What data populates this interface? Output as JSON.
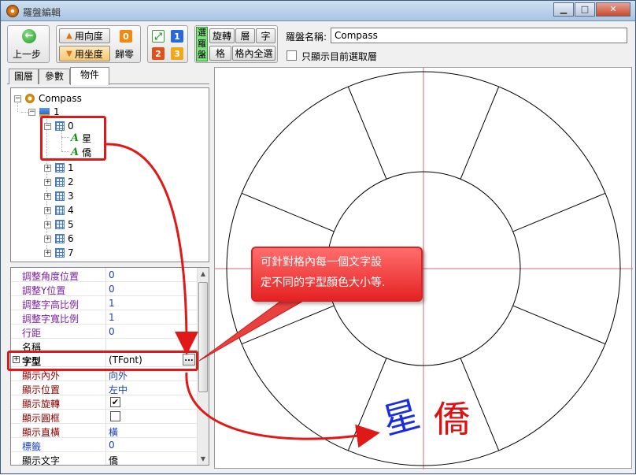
{
  "window": {
    "title": "羅盤編輯"
  },
  "toolbar": {
    "prev_step": "上一步",
    "use_angle": "用向度",
    "use_coord": "用坐度",
    "zero_badge": "0",
    "reset": "歸零",
    "badge1": "1",
    "badge2": "2",
    "badge3": "3",
    "select_compass_1": "選",
    "select_compass_2": "羅",
    "select_compass_3": "盤",
    "rotate": "旋轉",
    "layer": "層",
    "char": "字",
    "cell": "格",
    "cell_select_all": "格內全選",
    "name_label": "羅盤名稱:",
    "name_value": "Compass",
    "only_show_label": "只顯示目前選取層"
  },
  "tabs": [
    "圖層",
    "參數",
    "物件"
  ],
  "tree": {
    "root": "Compass",
    "layer": "1",
    "cell0": "0",
    "char1": "星",
    "char2": "僑",
    "cells": [
      "1",
      "2",
      "3",
      "4",
      "5",
      "6",
      "7"
    ]
  },
  "props": [
    {
      "name": "調整角度位置",
      "value": "0",
      "color": "#7a1fa0"
    },
    {
      "name": "調整Y位置",
      "value": "0",
      "color": "#7a1fa0"
    },
    {
      "name": "調整字高比例",
      "value": "1",
      "color": "#7a1fa0"
    },
    {
      "name": "調整字寬比例",
      "value": "1",
      "color": "#7a1fa0"
    },
    {
      "name": "行距",
      "value": "0",
      "color": "#7a1fa0"
    },
    {
      "name": "名稱",
      "value": "",
      "color": "#000000"
    },
    {
      "name": "字型",
      "value": "(TFont)",
      "color": "#000000"
    },
    {
      "name": "顯示內外",
      "value": "向外",
      "color": "#8b0000"
    },
    {
      "name": "顯示位置",
      "value": "左中",
      "color": "#8b0000"
    },
    {
      "name": "顯示旋轉",
      "value": "",
      "color": "#8b0000"
    },
    {
      "name": "顯示圓框",
      "value": "",
      "color": "#8b0000"
    },
    {
      "name": "顯示直橫",
      "value": "橫",
      "color": "#8b0000"
    },
    {
      "name": "標籤",
      "value": "0",
      "color": "#1c3fbf"
    },
    {
      "name": "顯示文字",
      "value": "僑",
      "color": "#000000"
    }
  ],
  "font_button": "...",
  "callout": {
    "line1": "可針對格內每一個文字設",
    "line2": "定不同的字型顏色大小等."
  },
  "canvas": {
    "char_blue": "星",
    "char_red": "僑",
    "blue_color": "#1a2ee0",
    "red_color": "#e01010"
  }
}
